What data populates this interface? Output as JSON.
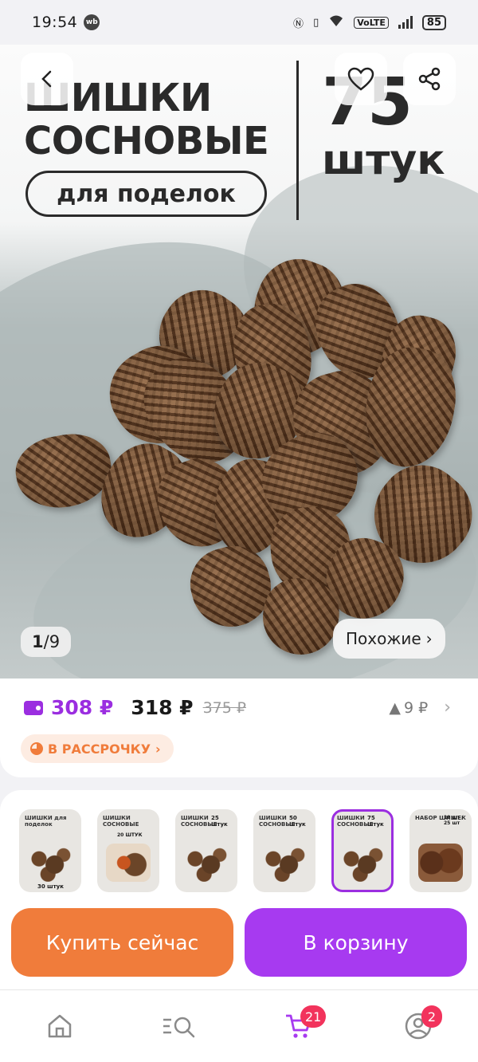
{
  "status_bar": {
    "time": "19:54",
    "app_badge": "wb",
    "network": "VoLTE",
    "battery": "85"
  },
  "hero": {
    "title_line1": "ШИШКИ",
    "title_line2": "СОСНОВЫЕ",
    "subtitle": "для поделок",
    "count_number": "75",
    "count_unit": "штук",
    "counter_current": "1",
    "counter_total": "/9",
    "similar_label": "Похожие"
  },
  "price": {
    "wallet_price": "308 ₽",
    "current_price": "318 ₽",
    "old_price": "375 ₽",
    "price_drop": "9 ₽",
    "installment_label": "В РАССРОЧКУ"
  },
  "thumbnails": [
    {
      "title": "ШИШКИ для поделок",
      "note": "30 штук",
      "selected": false
    },
    {
      "title": "ШИШКИ СОСНОВЫЕ",
      "note": "20 ШТУК",
      "selected": false
    },
    {
      "title": "ШИШКИ СОСНОВЫЕ",
      "note": "25 штук",
      "selected": false
    },
    {
      "title": "ШИШКИ СОСНОВЫЕ",
      "note": "50 штук",
      "selected": false
    },
    {
      "title": "ШИШКИ СОСНОВЫЕ",
      "note": "75 штук",
      "selected": true
    },
    {
      "title": "НАБОР ШИШЕК",
      "note": "10 шт / 25 шт",
      "selected": false
    }
  ],
  "actions": {
    "buy_now": "Купить сейчас",
    "add_to_cart": "В корзину"
  },
  "nav": {
    "cart_count": "21",
    "profile_count": "2"
  },
  "colors": {
    "accent": "#a73af0",
    "orange": "#f07c3b",
    "badge": "#f2335c"
  }
}
